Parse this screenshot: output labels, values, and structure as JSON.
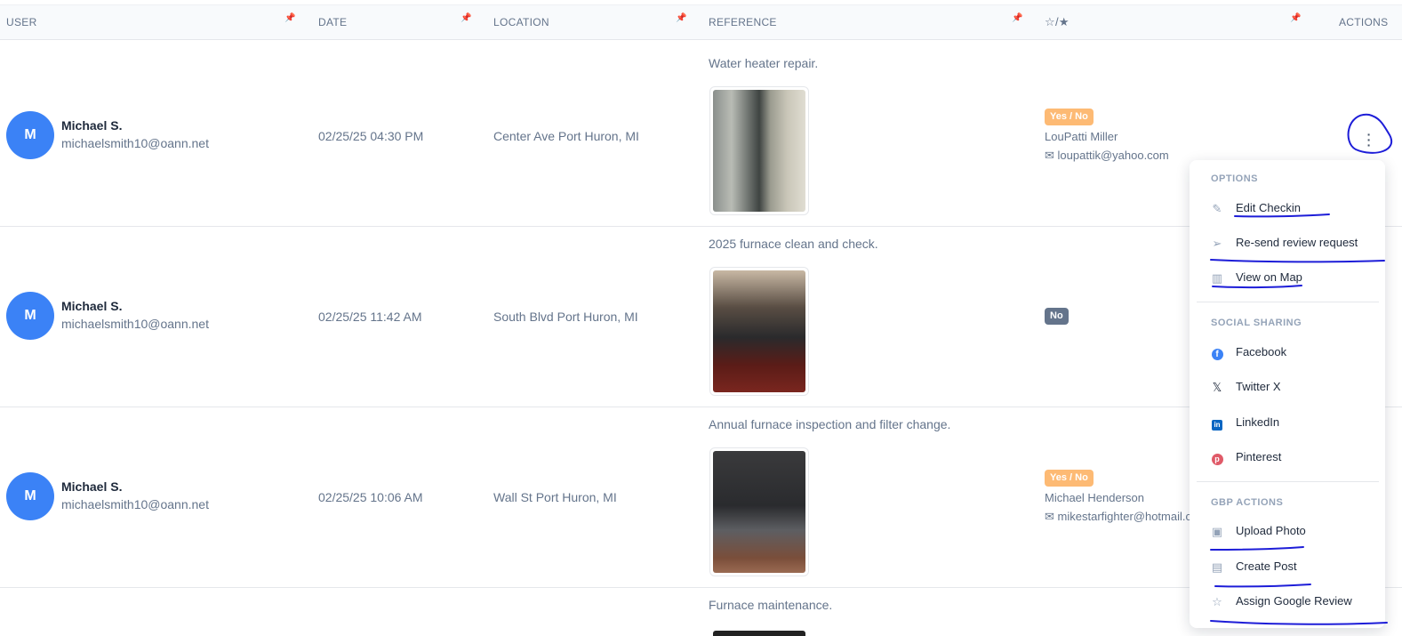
{
  "table": {
    "columns": {
      "user": "USER",
      "date": "DATE",
      "location": "LOCATION",
      "reference": "REFERENCE",
      "rating": "☆/★",
      "actions": "ACTIONS"
    },
    "rows": [
      {
        "initial": "M",
        "name": "Michael S.",
        "email": "michaelsmith10@oann.net",
        "date": "02/25/25 04:30 PM",
        "location": "Center Ave Port Huron, MI",
        "reference": "Water heater repair.",
        "badge": "Yes / No",
        "reviewer_name": "LouPatti Miller",
        "reviewer_email": "loupattik@yahoo.com"
      },
      {
        "initial": "M",
        "name": "Michael S.",
        "email": "michaelsmith10@oann.net",
        "date": "02/25/25 11:42 AM",
        "location": "South Blvd Port Huron, MI",
        "reference": "2025 furnace clean and check.",
        "badge": "No"
      },
      {
        "initial": "M",
        "name": "Michael S.",
        "email": "michaelsmith10@oann.net",
        "date": "02/25/25 10:06 AM",
        "location": "Wall St Port Huron, MI",
        "reference": "Annual furnace inspection and filter change.",
        "badge": "Yes / No",
        "reviewer_name": "Michael Henderson",
        "reviewer_email": "mikestarfighter@hotmail.c"
      },
      {
        "reference": "Furnace maintenance."
      }
    ]
  },
  "menu": {
    "options_title": "OPTIONS",
    "options": [
      "Edit Checkin",
      "Re-send review request",
      "View on Map"
    ],
    "social_title": "SOCIAL SHARING",
    "social": [
      "Facebook",
      "Twitter X",
      "LinkedIn",
      "Pinterest"
    ],
    "gbp_title": "GBP ACTIONS",
    "gbp": [
      "Upload Photo",
      "Create Post",
      "Assign Google Review"
    ]
  },
  "colors": {
    "avatar": "#3b82f6",
    "badge_orange": "#fdba74",
    "badge_gray": "#64748b",
    "annotation_ink": "#1d1dd8"
  },
  "icons": [
    "pin-icon",
    "more-vertical-icon",
    "edit-icon",
    "send-icon",
    "map-icon",
    "facebook-icon",
    "x-icon",
    "linkedin-icon",
    "pinterest-icon",
    "image-icon",
    "post-icon",
    "star-icon",
    "mail-icon"
  ]
}
